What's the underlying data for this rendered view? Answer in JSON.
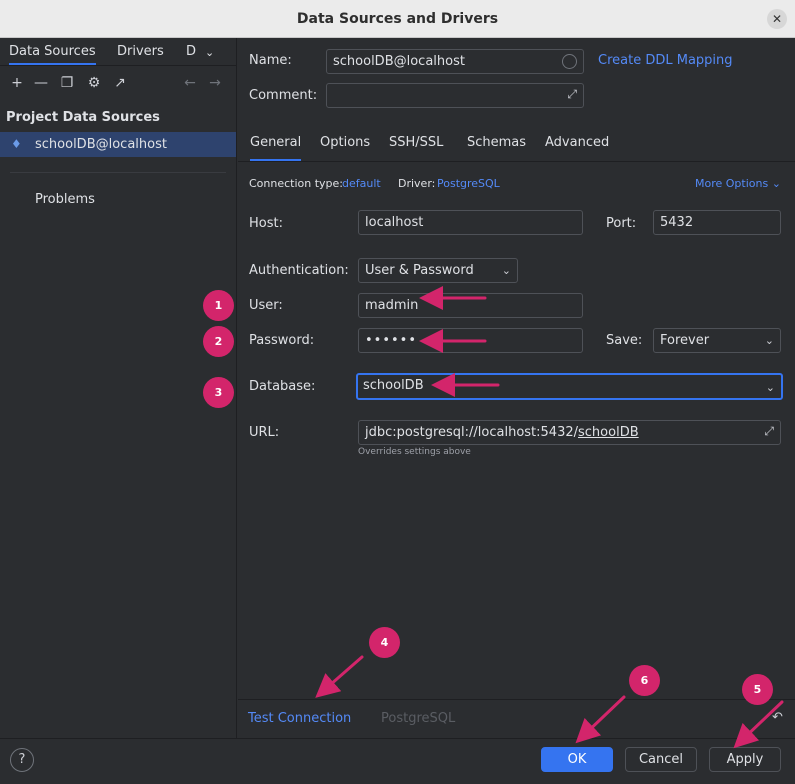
{
  "window": {
    "title": "Data Sources and Drivers",
    "close_glyph": "✕"
  },
  "left": {
    "tabs": [
      {
        "label": "Data Sources"
      },
      {
        "label": "Drivers"
      },
      {
        "label": "D"
      }
    ],
    "section_title": "Project Data Sources",
    "datasource": "schoolDB@localhost",
    "problems": "Problems"
  },
  "form": {
    "name_label": "Name:",
    "name_value": "schoolDB@localhost",
    "create_ddl": "Create DDL Mapping",
    "comment_label": "Comment:",
    "comment_value": "",
    "tabs": [
      {
        "label": "General"
      },
      {
        "label": "Options"
      },
      {
        "label": "SSH/SSL"
      },
      {
        "label": "Schemas"
      },
      {
        "label": "Advanced"
      }
    ],
    "conn_type_label": "Connection type:",
    "conn_type_value": "default",
    "driver_label": "Driver:",
    "driver_value": "PostgreSQL",
    "more_options": "More Options",
    "host_label": "Host:",
    "host_value": "localhost",
    "port_label": "Port:",
    "port_value": "5432",
    "auth_label": "Authentication:",
    "auth_value": "User & Password",
    "user_label": "User:",
    "user_value": "madmin",
    "password_label": "Password:",
    "password_value": "••••••",
    "save_label": "Save:",
    "save_value": "Forever",
    "database_label": "Database:",
    "database_value": "schoolDB",
    "url_label": "URL:",
    "url_prefix": "jdbc:postgresql://localhost:5432/",
    "url_db": "schoolDB",
    "url_hint": "Overrides settings above"
  },
  "bottom": {
    "test_connection": "Test Connection",
    "driver_name": "PostgreSQL"
  },
  "footer": {
    "help": "?",
    "ok": "OK",
    "cancel": "Cancel",
    "apply": "Apply"
  },
  "annotations": {
    "badges": [
      "1",
      "2",
      "3",
      "4",
      "5",
      "6"
    ],
    "color": "#d3256b"
  }
}
